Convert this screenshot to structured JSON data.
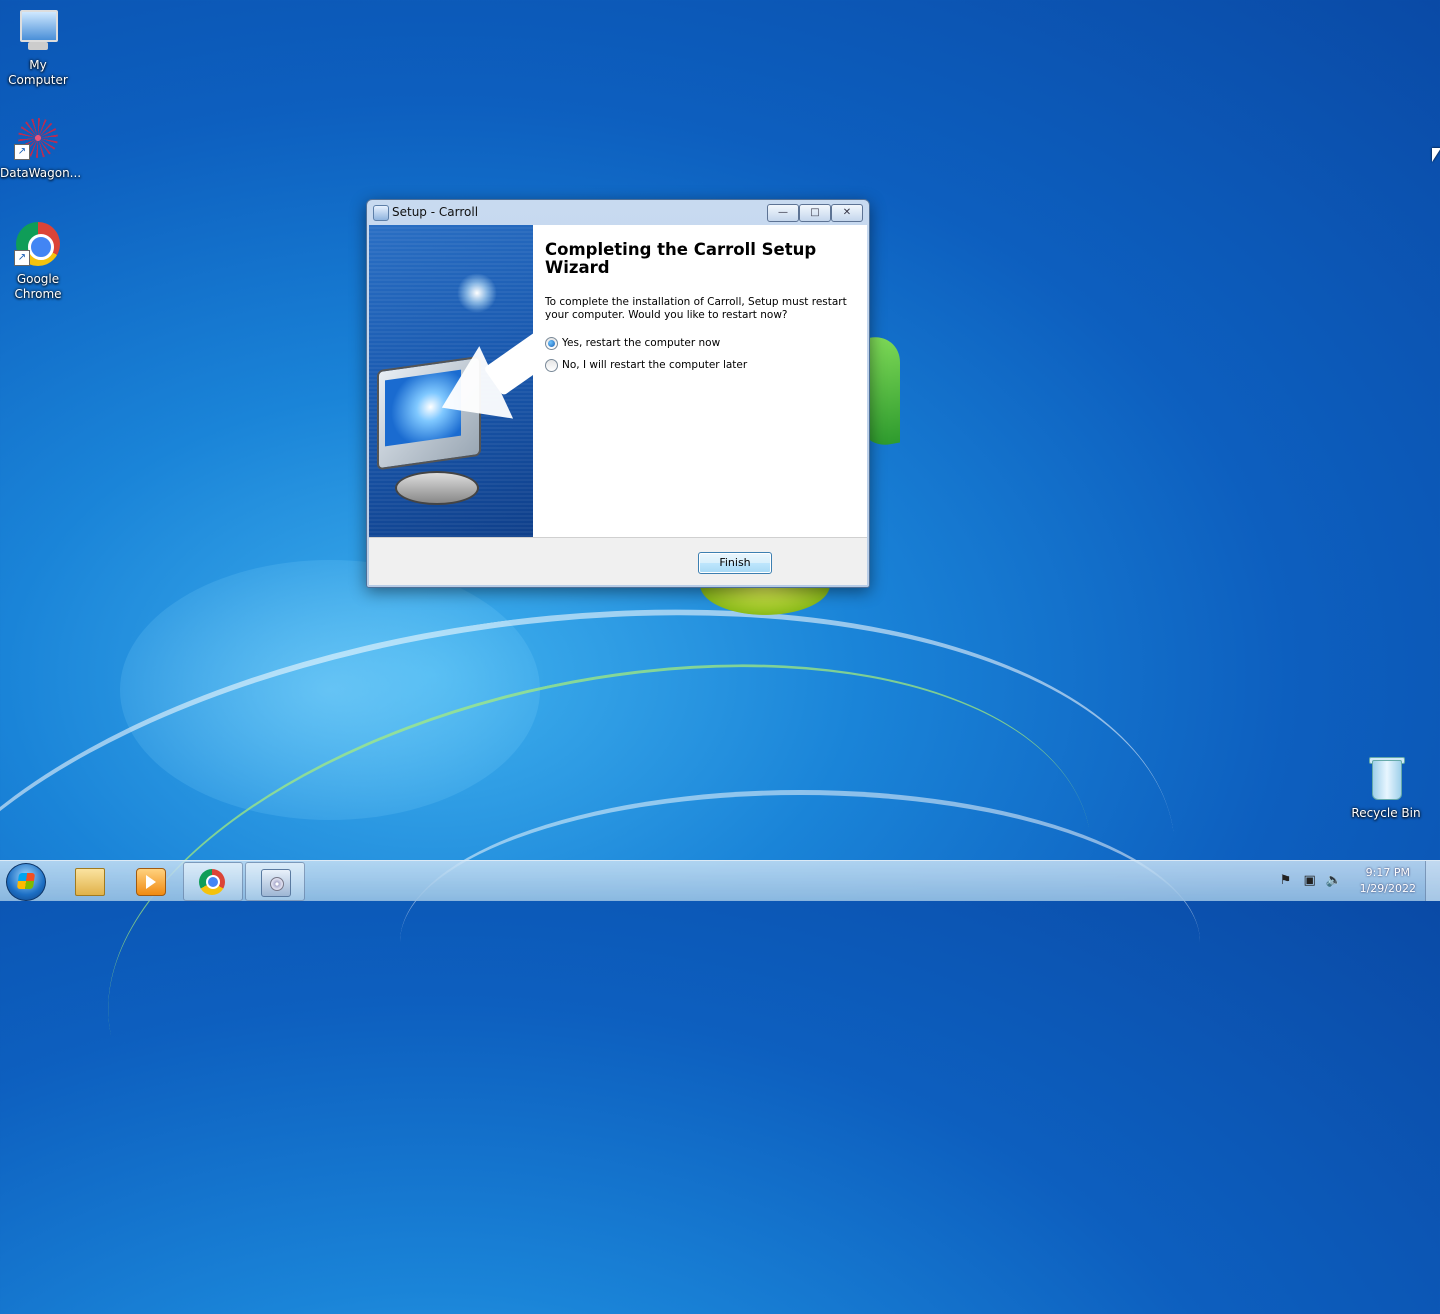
{
  "desktop": {
    "icons": [
      {
        "label": "My\nComputer",
        "line1": "My",
        "line2": "Computer"
      },
      {
        "label": "DataWagon..."
      },
      {
        "line1": "Google",
        "line2": "Chrome"
      },
      {
        "label": "Recycle Bin"
      }
    ]
  },
  "dialog": {
    "title": "Setup - Carroll",
    "controls": {
      "minimize": "—",
      "maximize": "□",
      "close": "✕"
    },
    "heading": "Completing the Carroll Setup Wizard",
    "description": "To complete the installation of Carroll, Setup must restart your computer. Would you like to restart now?",
    "options": [
      {
        "label": "Yes, restart the computer now",
        "checked": true
      },
      {
        "label": "No, I will restart the computer later",
        "checked": false
      }
    ],
    "finish_label": "Finish"
  },
  "taskbar": {
    "items": [
      "windows-explorer",
      "windows-media-player",
      "google-chrome",
      "setup-carroll"
    ],
    "tray": {
      "icons": [
        "action-center-flag-icon",
        "network-icon",
        "volume-icon"
      ],
      "time": "9:17 PM",
      "date": "1/29/2022"
    }
  },
  "colors": {
    "desktop_blue": "#1a84d8",
    "title_bar": "#c8daf0",
    "button_accent": "#3c7fb1"
  }
}
